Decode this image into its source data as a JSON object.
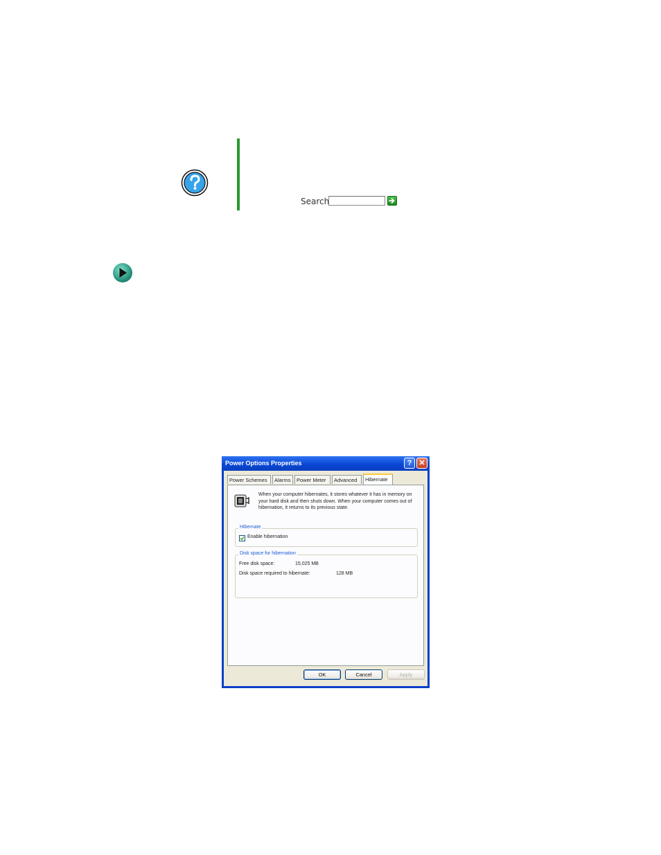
{
  "search": {
    "label": "Search",
    "value": ""
  },
  "dialog": {
    "title": "Power Options Properties",
    "help_glyph": "?",
    "close_glyph": "✕",
    "tabs": [
      {
        "label": "Power Schemes"
      },
      {
        "label": "Alarms"
      },
      {
        "label": "Power Meter"
      },
      {
        "label": "Advanced"
      },
      {
        "label": "Hibernate"
      }
    ],
    "active_tab": "Hibernate",
    "intro_text": "When your computer hibernates, it stores whatever it has in memory on your hard disk and then shuts down. When your computer comes out of hibernation, it returns to its previous state.",
    "hibernate_group": {
      "legend": "Hibernate",
      "checkbox_label": "Enable hibernation",
      "checked": true
    },
    "disk_group": {
      "legend": "Disk space for hibernation",
      "free_label": "Free disk space:",
      "free_value": "15,025 MB",
      "required_label": "Disk space required to hibernate:",
      "required_value": "128 MB"
    },
    "buttons": {
      "ok": "OK",
      "cancel": "Cancel",
      "apply": "Apply"
    }
  },
  "colors": {
    "accent_green": "#2a9a2a",
    "titlebar_blue": "#0a47d6",
    "legend_blue": "#1d5bd6"
  },
  "icons": [
    "help-circle-icon",
    "go-arrow-icon",
    "arrow-bullet-icon",
    "battery-plug-icon",
    "checkmark-icon"
  ]
}
